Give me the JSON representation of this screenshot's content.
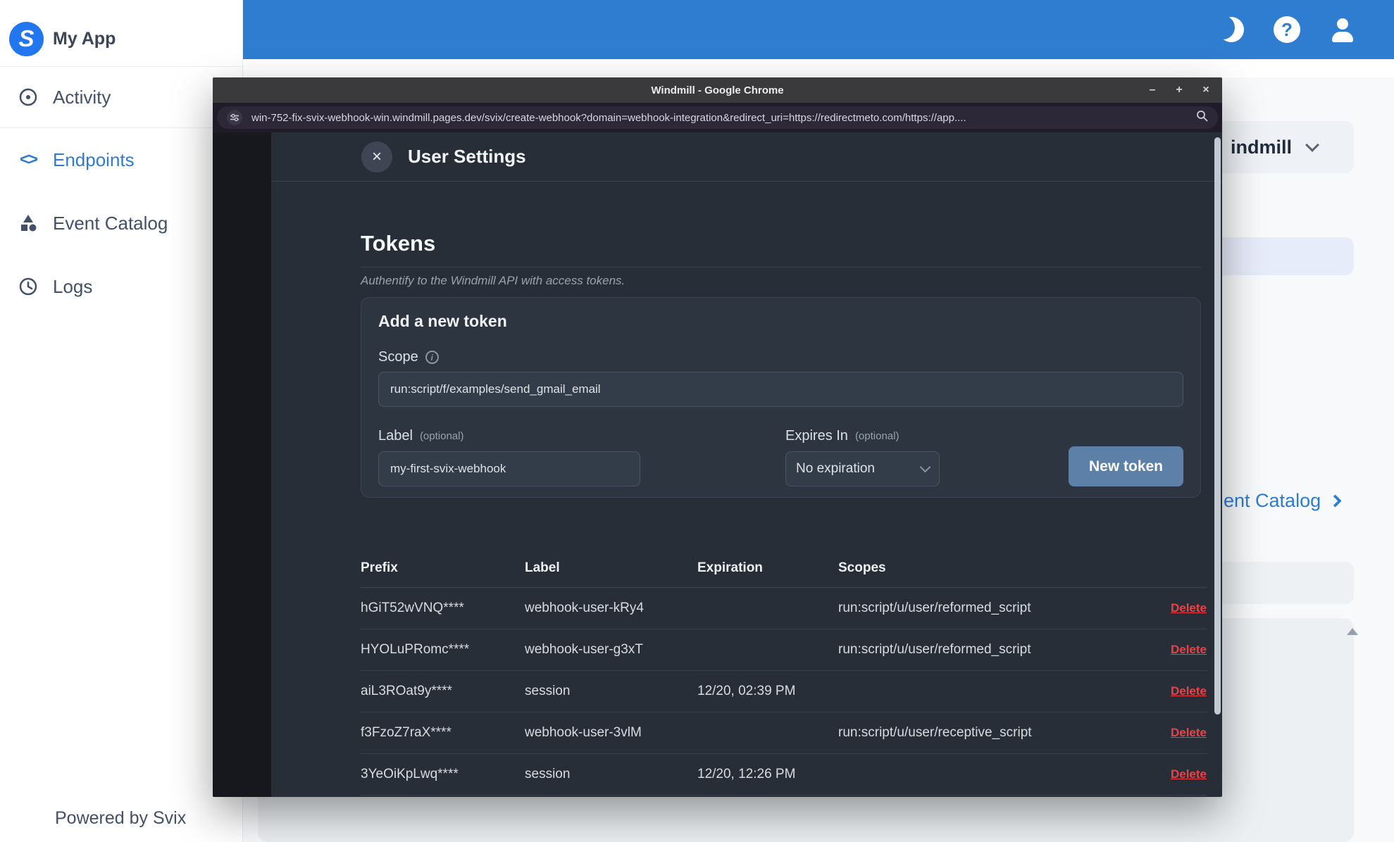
{
  "sidebar": {
    "app_name": "My App",
    "logo_letter": "S",
    "items": [
      {
        "label": "Activity"
      },
      {
        "label": "Endpoints",
        "active": true
      },
      {
        "label": "Event Catalog"
      },
      {
        "label": "Logs"
      }
    ],
    "footer": "Powered by Svix"
  },
  "background_page": {
    "workspace_label": "indmill",
    "catalog_link": "ent Catalog"
  },
  "chrome": {
    "title": "Windmill - Google Chrome",
    "url": "win-752-fix-svix-webhook-win.windmill.pages.dev/svix/create-webhook?domain=webhook-integration&redirect_uri=https://redirectmeto.com/https://app....",
    "controls": {
      "minimize": "–",
      "maximize": "+",
      "close": "×"
    }
  },
  "modal": {
    "close_glyph": "×",
    "title": "User Settings",
    "section_title": "Tokens",
    "section_subtitle": "Authentify to the Windmill API with access tokens.",
    "add_token": {
      "title": "Add a new token",
      "scope_label": "Scope",
      "info_glyph": "i",
      "scope_value": "run:script/f/examples/send_gmail_email",
      "label_label": "Label",
      "optional": "(optional)",
      "label_value": "my-first-svix-webhook",
      "expires_label": "Expires In",
      "expires_value": "No expiration",
      "button": "New token"
    },
    "table": {
      "columns": {
        "prefix": "Prefix",
        "label": "Label",
        "expiration": "Expiration",
        "scopes": "Scopes"
      },
      "delete_label": "Delete",
      "rows": [
        {
          "prefix": "hGiT52wVNQ****",
          "label": "webhook-user-kRy4",
          "expiration": "",
          "scopes": "run:script/u/user/reformed_script"
        },
        {
          "prefix": "HYOLuPRomc****",
          "label": "webhook-user-g3xT",
          "expiration": "",
          "scopes": "run:script/u/user/reformed_script"
        },
        {
          "prefix": "aiL3ROat9y****",
          "label": "session",
          "expiration": "12/20, 02:39 PM",
          "scopes": ""
        },
        {
          "prefix": "f3FzoZ7raX****",
          "label": "webhook-user-3vlM",
          "expiration": "",
          "scopes": "run:script/u/user/receptive_script"
        },
        {
          "prefix": "3YeOiKpLwq****",
          "label": "session",
          "expiration": "12/20, 12:26 PM",
          "scopes": ""
        }
      ]
    }
  },
  "icons": {
    "logo": "S",
    "activity": "disc",
    "endpoints": "<>",
    "event_catalog": "shapes",
    "logs": "clock",
    "moon": "crescent",
    "help": "?",
    "user": "person",
    "site_settings": "tune",
    "search": "magnifier"
  },
  "colors": {
    "header_blue": "#2e7dd1",
    "active_blue": "#2e7cd0",
    "modal_bg": "#272e38",
    "card_bg": "#2d3541",
    "delete_red": "#ee4146",
    "button_blue": "#5d80a9"
  }
}
